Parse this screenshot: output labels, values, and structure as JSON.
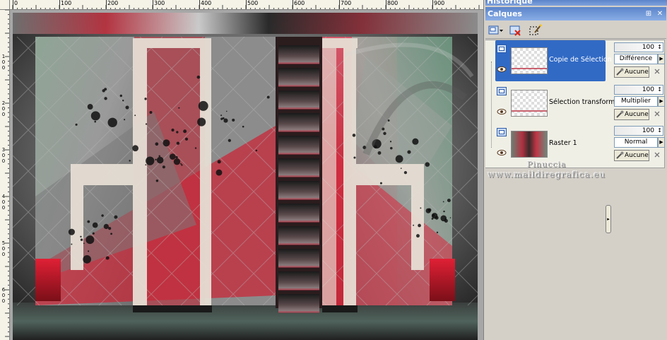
{
  "historique": {
    "title": "Historique"
  },
  "calques": {
    "title": "Calques",
    "window_controls": [
      "⊞",
      "✕"
    ]
  },
  "ruler": {
    "top_labels": [
      "0",
      "100",
      "200",
      "300",
      "400",
      "500",
      "600",
      "700",
      "800",
      "900"
    ],
    "left_labels": [
      "1 0 0",
      "2 0 0",
      "3 0 0",
      "4 0 0",
      "5 0 0",
      "6 0 0"
    ]
  },
  "layers": [
    {
      "name": "Copie de Sélection",
      "opacity": "100",
      "blend": "Différence",
      "group": "Aucune",
      "selected": true
    },
    {
      "name": "Sélection transform",
      "opacity": "100",
      "blend": "Multiplier",
      "group": "Aucune",
      "selected": false
    },
    {
      "name": "Raster 1",
      "opacity": "100",
      "blend": "Normal",
      "group": "Aucune",
      "selected": false
    }
  ],
  "watermark": {
    "line1": "Pinuccia",
    "line2": "www.maildiregrafica.eu"
  },
  "colors": {
    "panel_bg": "#d4d0c8",
    "title_bar": "#5b84c9",
    "selection": "#316ac5",
    "canvas_red": "#d22a3c",
    "canvas_green": "#7f9a88",
    "canvas_cream": "#e8e0d6"
  }
}
